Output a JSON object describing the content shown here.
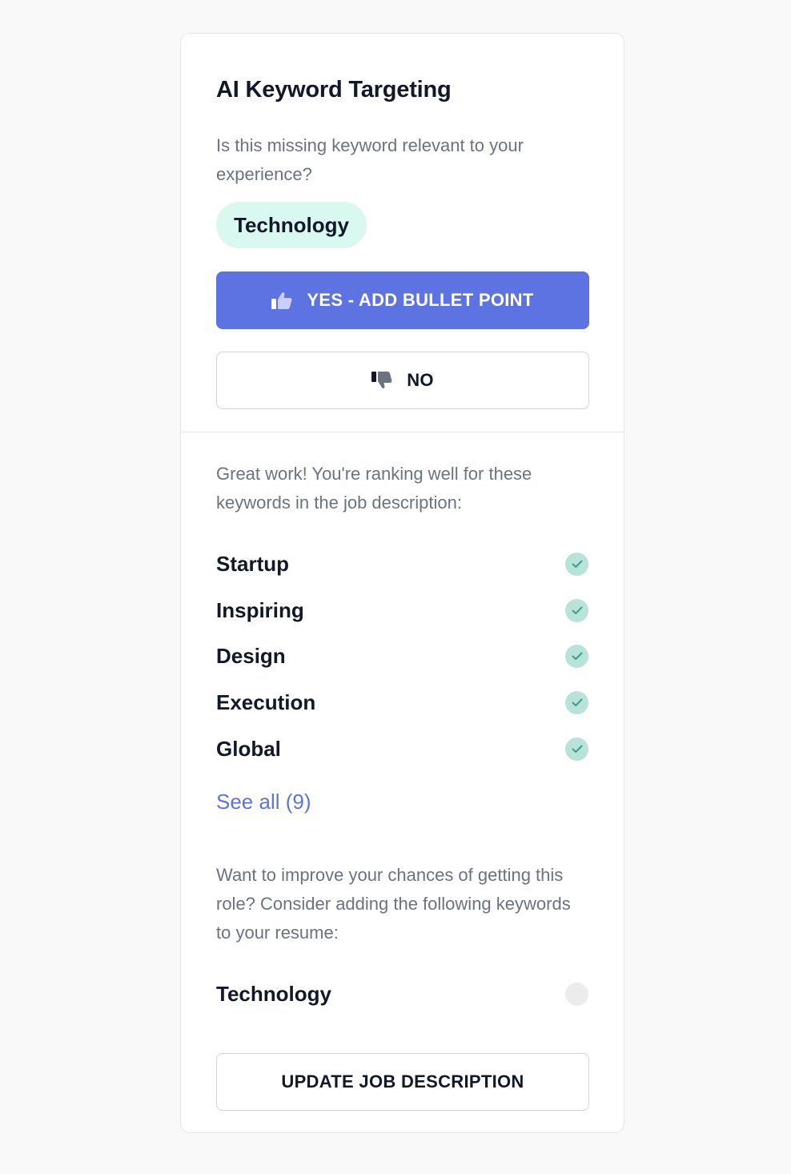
{
  "panel": {
    "title": "AI Keyword Targeting",
    "question": "Is this missing keyword relevant to your experience?",
    "suggested_keyword": "Technology",
    "yes_button": {
      "label": "YES - ADD BULLET POINT",
      "icon": "thumbs-up-icon"
    },
    "no_button": {
      "label": "NO",
      "icon": "thumbs-down-icon"
    }
  },
  "ranking": {
    "message": "Great work! You're ranking well for these keywords in the job description:",
    "keywords": [
      {
        "label": "Startup",
        "status": "matched"
      },
      {
        "label": "Inspiring",
        "status": "matched"
      },
      {
        "label": "Design",
        "status": "matched"
      },
      {
        "label": "Execution",
        "status": "matched"
      },
      {
        "label": "Global",
        "status": "matched"
      }
    ],
    "see_all_label": "See all (9)"
  },
  "improve": {
    "message": "Want to improve your chances of getting this role? Consider adding the following keywords to your resume:",
    "keywords": [
      {
        "label": "Technology",
        "status": "missing"
      }
    ],
    "update_button_label": "UPDATE JOB DESCRIPTION"
  },
  "colors": {
    "accent": "#5e73e2",
    "chip_bg": "#d9f8f0",
    "check_bg": "#b8e3d8",
    "check_mark": "#3f9e86",
    "muted_text": "#6b7280"
  }
}
